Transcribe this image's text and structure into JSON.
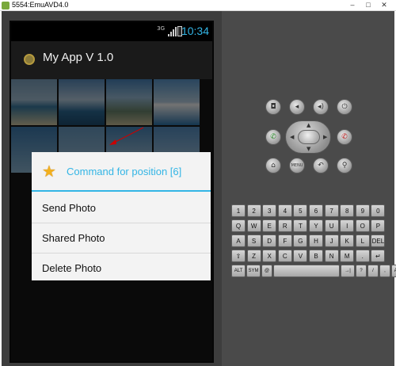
{
  "window": {
    "title": "5554:EmuAVD4.0",
    "min_label": "–",
    "max_label": "□",
    "close_label": "✕"
  },
  "status_bar": {
    "network": "3G",
    "time": "10:34"
  },
  "action_bar": {
    "title": "My App V 1.0",
    "icon": "app-icon"
  },
  "dialog": {
    "title": "Command for position [6]",
    "icon": "star-icon",
    "items": [
      "Send Photo",
      "Shared Photo",
      "Delete Photo"
    ]
  },
  "hardware": {
    "buttons": [
      "camera-icon",
      "volume-down-icon",
      "volume-up-icon",
      "power-icon",
      "call-icon",
      "end-call-icon",
      "home-icon",
      "menu-icon",
      "back-icon",
      "search-icon"
    ],
    "menu_label": "MENU"
  },
  "keyboard": {
    "row1": [
      "1",
      "2",
      "3",
      "4",
      "5",
      "6",
      "7",
      "8",
      "9",
      "0"
    ],
    "row2": [
      "Q",
      "W",
      "E",
      "R",
      "T",
      "Y",
      "U",
      "I",
      "O",
      "P"
    ],
    "row3": [
      "A",
      "S",
      "D",
      "F",
      "G",
      "H",
      "J",
      "K",
      "L",
      "DEL"
    ],
    "row4": [
      "⇧",
      "Z",
      "X",
      "C",
      "V",
      "B",
      "N",
      "M",
      ".",
      "↵"
    ],
    "row5": [
      "ALT",
      "SYM",
      "@",
      "",
      "→|",
      "?",
      "/",
      ",",
      "ALT"
    ]
  },
  "colors": {
    "accent": "#33b5e5",
    "star": "#f2b01e",
    "annotation": "#cc0000"
  }
}
